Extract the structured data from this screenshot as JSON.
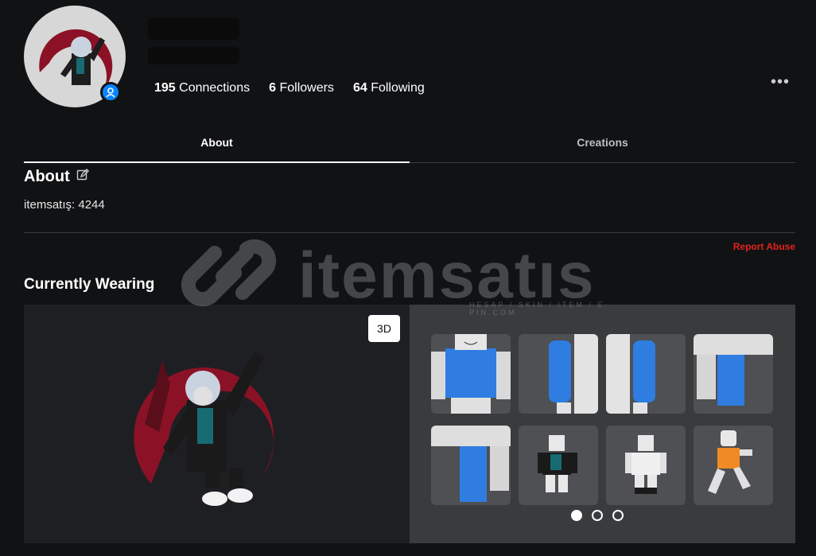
{
  "profile": {
    "stats": {
      "connections_count": "195",
      "connections_label": "Connections",
      "followers_count": "6",
      "followers_label": "Followers",
      "following_count": "64",
      "following_label": "Following"
    },
    "more_label": "•••"
  },
  "tabs": [
    {
      "label": "About",
      "active": true
    },
    {
      "label": "Creations",
      "active": false
    }
  ],
  "about": {
    "title": "About",
    "description": "itemsatış: 4244",
    "report_label": "Report Abuse"
  },
  "wearing": {
    "title": "Currently Wearing",
    "view_toggle": "3D",
    "items": [
      "shirt",
      "left-arm",
      "right-arm",
      "right-leg",
      "left-leg",
      "jacket-outfit",
      "white-outfit",
      "run-animation"
    ],
    "pages": 3,
    "current_page": 1
  },
  "watermark": {
    "word": "itemsatıs",
    "sub": "HESAP / SKIN / ITEM / E-PIN.COM"
  },
  "colors": {
    "background": "#111214",
    "accent_red": "#e2231a",
    "presence_blue": "#0a84ff",
    "panel_dark": "#1e1f23",
    "panel_gray": "#393b3d"
  }
}
